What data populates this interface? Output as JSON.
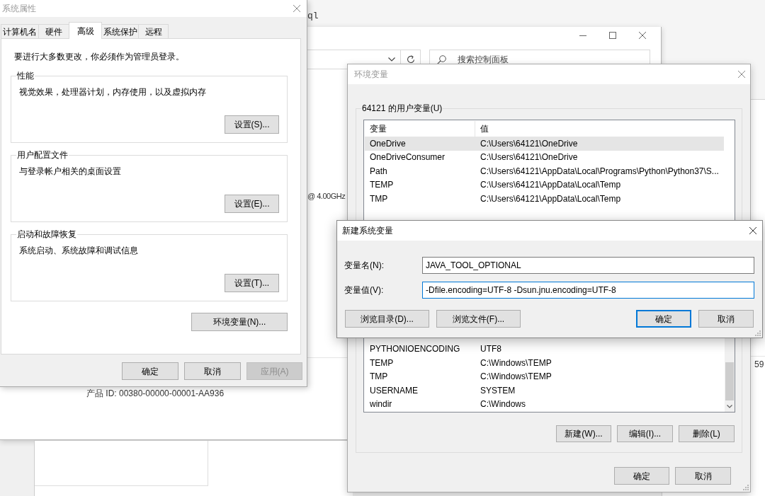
{
  "editor": {
    "text": "ql"
  },
  "control_panel_window": {
    "search": {
      "placeholder": "搜索控制面板"
    },
    "processor_text": "@ 4.00GHz",
    "product_id": "产品 ID: 00380-00000-00001-AA936"
  },
  "side_window": {
    "text": "59"
  },
  "system_properties": {
    "title": "系统属性",
    "active": false,
    "tabs": [
      {
        "label": "计算机名",
        "selected": false
      },
      {
        "label": "硬件",
        "selected": false
      },
      {
        "label": "高级",
        "selected": true
      },
      {
        "label": "系统保护",
        "selected": false
      },
      {
        "label": "远程",
        "selected": false
      }
    ],
    "notice": "要进行大多数更改，你必须作为管理员登录。",
    "groups": [
      {
        "title": "性能",
        "description": "视觉效果，处理器计划，内存使用，以及虚拟内存",
        "button": "设置(S)..."
      },
      {
        "title": "用户配置文件",
        "description": "与登录帐户相关的桌面设置",
        "button": "设置(E)..."
      },
      {
        "title": "启动和故障恢复",
        "description": "系统启动、系统故障和调试信息",
        "button": "设置(T)..."
      }
    ],
    "environment_button": "环境变量(N)...",
    "buttons": [
      {
        "label": "确定",
        "disabled": false
      },
      {
        "label": "取消",
        "disabled": false
      },
      {
        "label": "应用(A)",
        "disabled": true
      }
    ]
  },
  "environment_variables": {
    "title": "环境变量",
    "active": false,
    "user_variables": {
      "title": "64121 的用户变量(U)",
      "columns": [
        "变量",
        "值"
      ],
      "rows": [
        {
          "name": "OneDrive",
          "value": "C:\\Users\\64121\\OneDrive",
          "selected": true
        },
        {
          "name": "OneDriveConsumer",
          "value": "C:\\Users\\64121\\OneDrive",
          "selected": false
        },
        {
          "name": "Path",
          "value": "C:\\Users\\64121\\AppData\\Local\\Programs\\Python\\Python37\\S...",
          "selected": false
        },
        {
          "name": "TEMP",
          "value": "C:\\Users\\64121\\AppData\\Local\\Temp",
          "selected": false
        },
        {
          "name": "TMP",
          "value": "C:\\Users\\64121\\AppData\\Local\\Temp",
          "selected": false
        }
      ]
    },
    "system_variables": {
      "rows": [
        {
          "name": "PYTHONIOENCODING",
          "value": "UTF8",
          "selected": false
        },
        {
          "name": "TEMP",
          "value": "C:\\Windows\\TEMP",
          "selected": false
        },
        {
          "name": "TMP",
          "value": "C:\\Windows\\TEMP",
          "selected": false
        },
        {
          "name": "USERNAME",
          "value": "SYSTEM",
          "selected": false
        },
        {
          "name": "windir",
          "value": "C:\\Windows",
          "selected": false
        }
      ]
    },
    "list_buttons": [
      "新建(W)...",
      "编辑(I)...",
      "删除(L)"
    ],
    "buttons": [
      "确定",
      "取消"
    ]
  },
  "new_variable_dialog": {
    "title": "新建系统变量",
    "active": true,
    "fields": [
      {
        "label": "变量名(N):",
        "value": "JAVA_TOOL_OPTIONAL",
        "focused": false
      },
      {
        "label": "变量值(V):",
        "value": "-Dfile.encoding=UTF-8 -Dsun.jnu.encoding=UTF-8",
        "focused": true
      }
    ],
    "buttons": [
      {
        "label": "浏览目录(D)...",
        "focused": false
      },
      {
        "label": "浏览文件(F)...",
        "focused": false
      },
      {
        "label": "确定",
        "focused": true
      },
      {
        "label": "取消",
        "focused": false
      }
    ]
  }
}
